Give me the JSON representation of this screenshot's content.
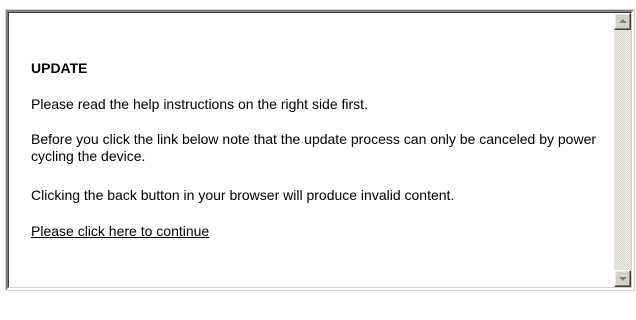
{
  "panel": {
    "title": "UPDATE",
    "paragraphs": [
      "Please read the help instructions on the right side first.",
      "Before you click the link below note that the update process can only be canceled by power cycling the device.",
      "Clicking the back button in your browser will produce invalid content."
    ],
    "link_text": "Please click here to continue"
  },
  "scrollbar": {
    "up_icon": "arrow-up-icon",
    "down_icon": "arrow-down-icon"
  },
  "colors": {
    "face": "#d4d0c8",
    "text": "#000000",
    "background": "#ffffff",
    "arrow": "#808080"
  }
}
